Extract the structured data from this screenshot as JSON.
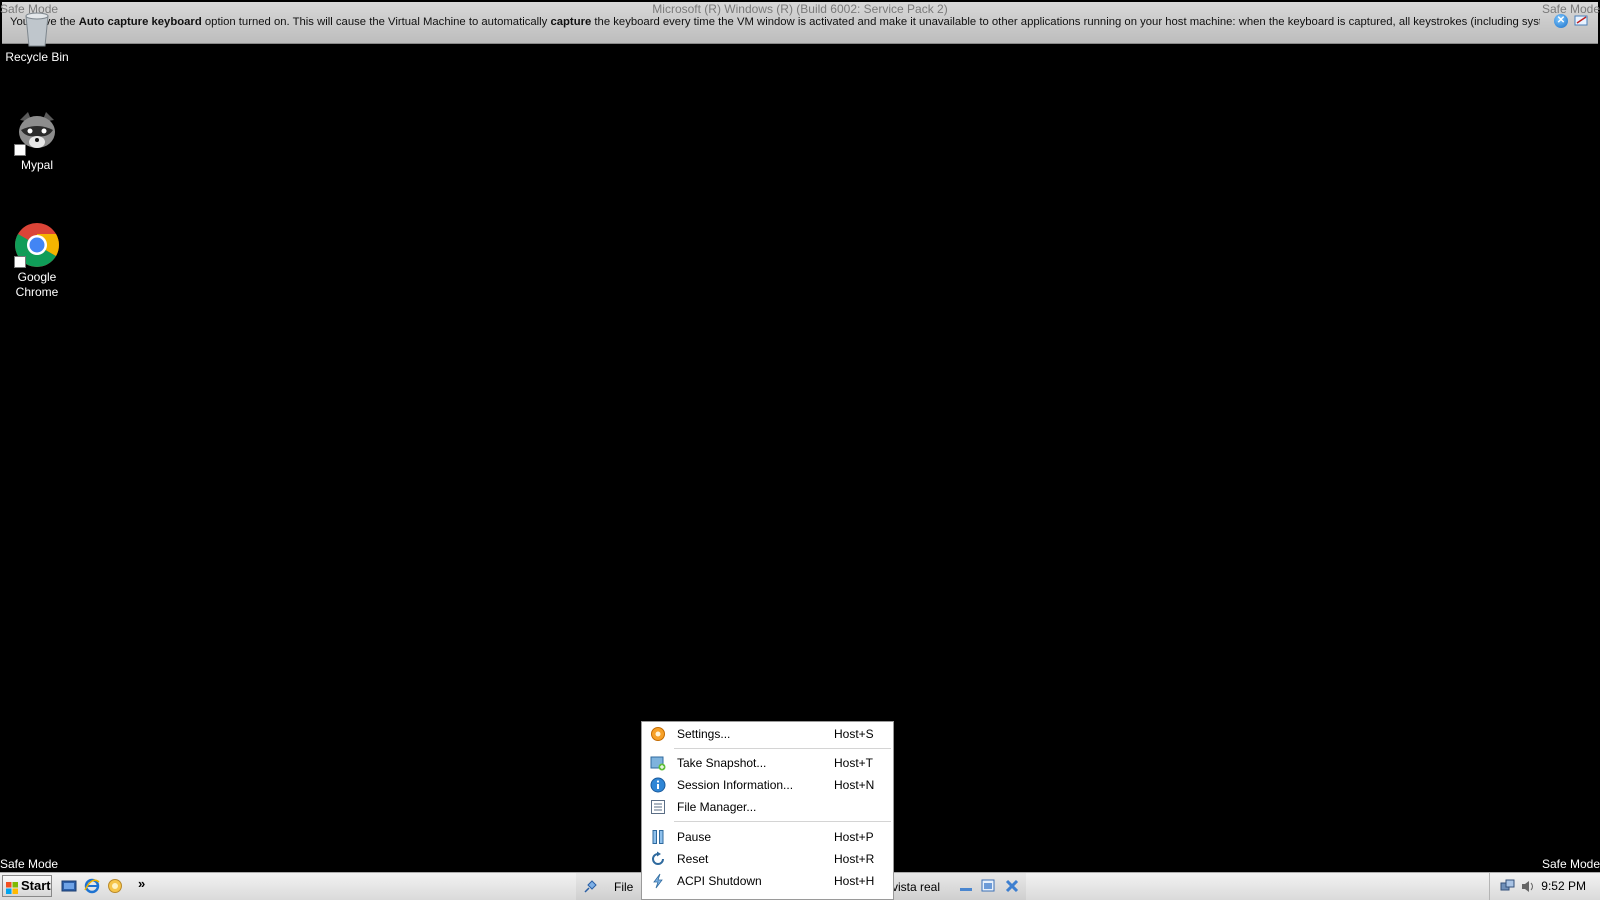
{
  "notification": {
    "window_title": "Microsoft (R) Windows (R) (Build 6002: Service Pack 2)",
    "safe_mode_left": "Safe Mode",
    "safe_mode_right": "Safe Mode",
    "msg_part1": "You have the ",
    "msg_bold1": "Auto capture keyboard",
    "msg_part2": " option turned on. This will cause the Virtual Machine to automatically ",
    "msg_bold2": "capture",
    "msg_part3": " the keyboard every time the VM window is activated and make it unavailable to other applications running on your host machine: when the keyboard is captured, all keystrokes (including system ones"
  },
  "desktop": {
    "icons": [
      {
        "label": "Recycle Bin"
      },
      {
        "label": "Mypal"
      },
      {
        "label": "Google Chrome"
      }
    ],
    "safe_mode_bottom_left": "Safe Mode",
    "safe_mode_bottom_right": "Safe Mode"
  },
  "taskbar": {
    "start_label": "Start",
    "quick_launch_more": "»",
    "file_menu": "File",
    "vm_name": "vista real",
    "clock": "9:52 PM"
  },
  "menu": {
    "items": [
      {
        "label": "Settings...",
        "shortcut": "Host+S",
        "icon": "settings-icon"
      },
      {
        "label": "Take Snapshot...",
        "shortcut": "Host+T",
        "icon": "snapshot-icon"
      },
      {
        "label": "Session Information...",
        "shortcut": "Host+N",
        "icon": "info-icon"
      },
      {
        "label": "File Manager...",
        "shortcut": "",
        "icon": "file-manager-icon"
      },
      {
        "label": "Pause",
        "shortcut": "Host+P",
        "icon": "pause-icon"
      },
      {
        "label": "Reset",
        "shortcut": "Host+R",
        "icon": "reset-icon"
      },
      {
        "label": "ACPI Shutdown",
        "shortcut": "Host+H",
        "icon": "acpi-shutdown-icon"
      }
    ]
  },
  "colors": {
    "desktop_bg": "#000000",
    "notification_bg": "#c8c8c8",
    "menu_bg": "#ffffff",
    "info_blue": "#1a6fc8"
  }
}
